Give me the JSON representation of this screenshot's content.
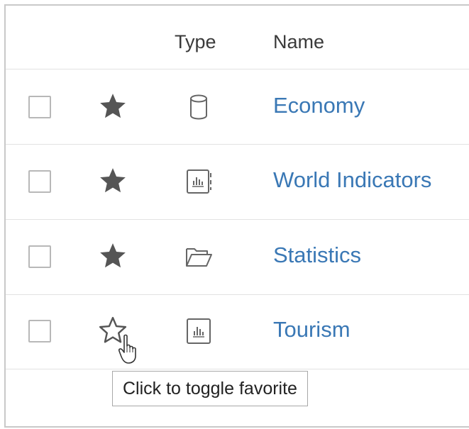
{
  "header": {
    "type_label": "Type",
    "name_label": "Name"
  },
  "rows": [
    {
      "name": "Economy",
      "favorite": true,
      "type_icon": "data-source-cylinder-icon"
    },
    {
      "name": "World Indicators",
      "favorite": true,
      "type_icon": "workbook-icon"
    },
    {
      "name": "Statistics",
      "favorite": true,
      "type_icon": "folder-open-icon"
    },
    {
      "name": "Tourism",
      "favorite": false,
      "type_icon": "view-chart-icon"
    }
  ],
  "tooltip": {
    "text": "Click to toggle favorite"
  },
  "colors": {
    "link": "#3a78b5",
    "star": "#555555",
    "border": "#c9c9c9"
  }
}
